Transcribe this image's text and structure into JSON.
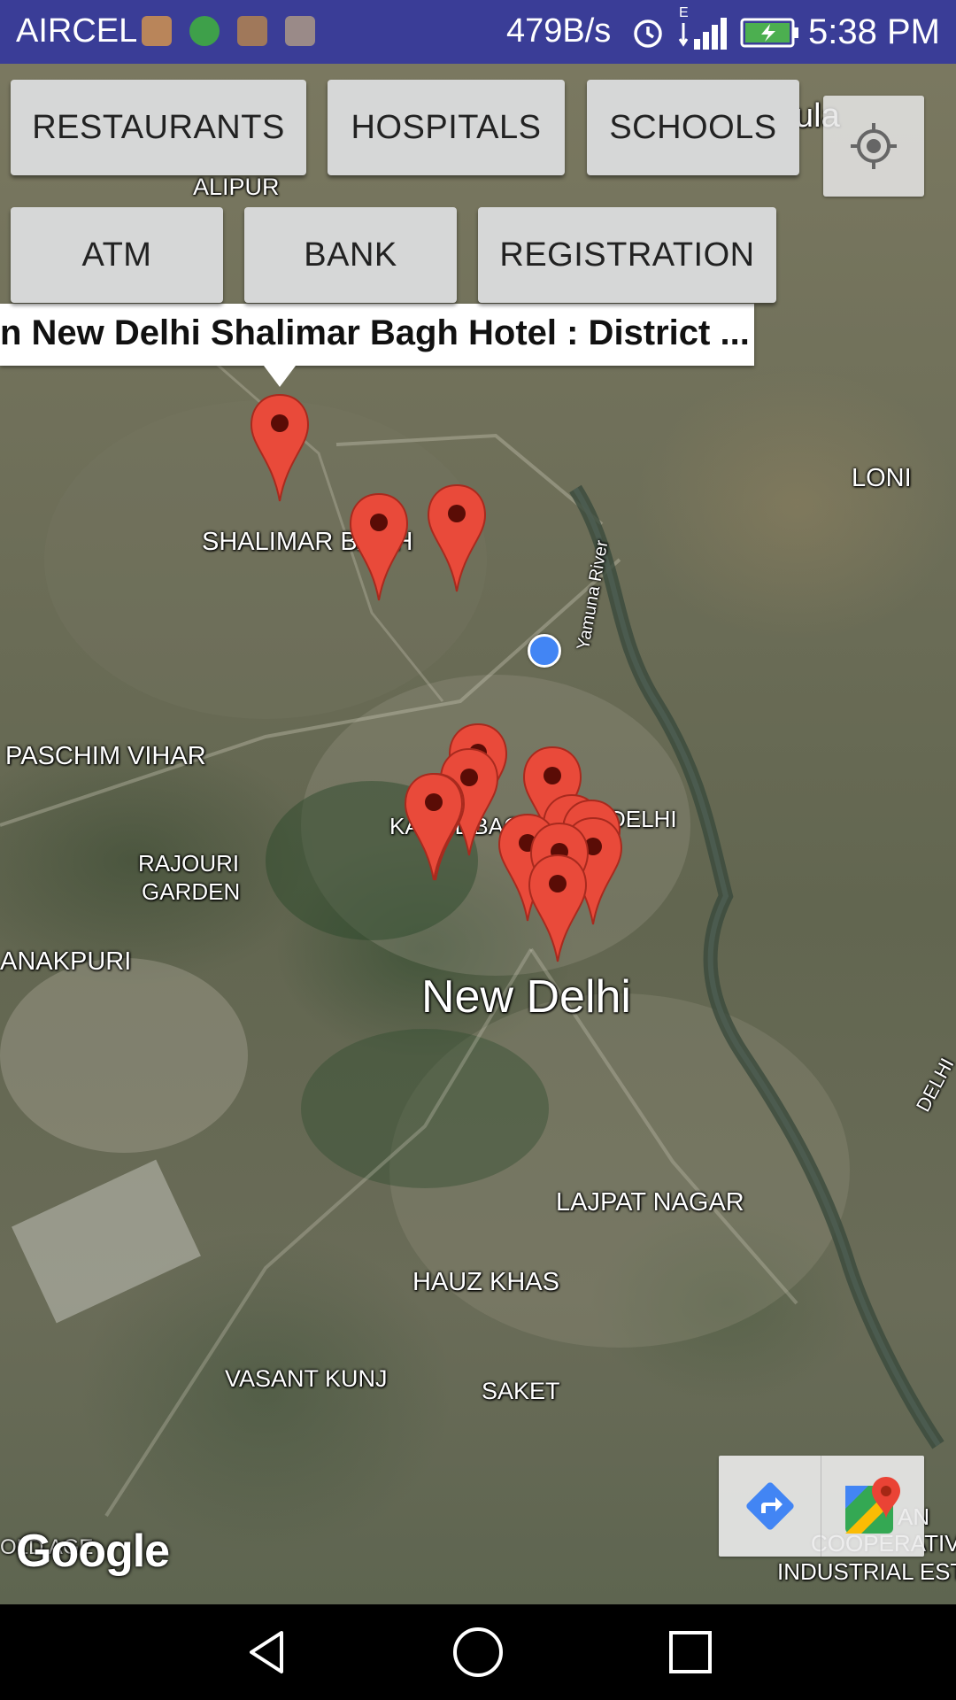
{
  "status_bar": {
    "carrier": "AIRCEL",
    "network_speed": "479B/s",
    "network_type": "E",
    "time": "5:38 PM",
    "icons": [
      "maps-icon",
      "globe-icon",
      "usb-icon",
      "message-icon",
      "alarm-icon",
      "signal-icon",
      "battery-charging-icon"
    ]
  },
  "buttons": {
    "restaurants": "RESTAURANTS",
    "hospitals": "HOSPITALS",
    "schools": "SCHOOLS",
    "atm": "ATM",
    "bank": "BANK",
    "registration": "REGISTRATION"
  },
  "info_window": {
    "text": "n New Delhi Shalimar Bagh Hotel : District ..."
  },
  "map_labels": {
    "alipur": "ALIPUR",
    "partial_top": "ula",
    "loni": "LONI",
    "shalimar_bagh": "SHALIMAR BAGH",
    "yamuna": "Yamuna River",
    "paschim_vihar": "PASCHIM VIHAR",
    "karol_bagh": "KAROL BAGH",
    "delhi": "DELHI",
    "rajouri_1": "RAJOURI",
    "rajouri_2": "GARDEN",
    "janakpuri": "ANAKPURI",
    "new_delhi": "New Delhi",
    "delhi_edge": "DELHI",
    "lajpat_nagar": "LAJPAT NAGAR",
    "hauz_khas": "HAUZ KHAS",
    "vasant_kunj": "VASANT KUNJ",
    "saket": "SAKET",
    "coop_1": "AN",
    "coop_2": "COOPERATIVE",
    "coop_3": "INDUSTRIAL EST",
    "partial_bottom_left": "OLD AGE",
    "google": "Google"
  },
  "map_controls": {
    "locate": "my-location-icon",
    "directions": "directions-icon",
    "open_maps": "google-maps-icon"
  },
  "nav_bar": {
    "icons": [
      "back-icon",
      "home-icon",
      "recents-icon"
    ]
  }
}
